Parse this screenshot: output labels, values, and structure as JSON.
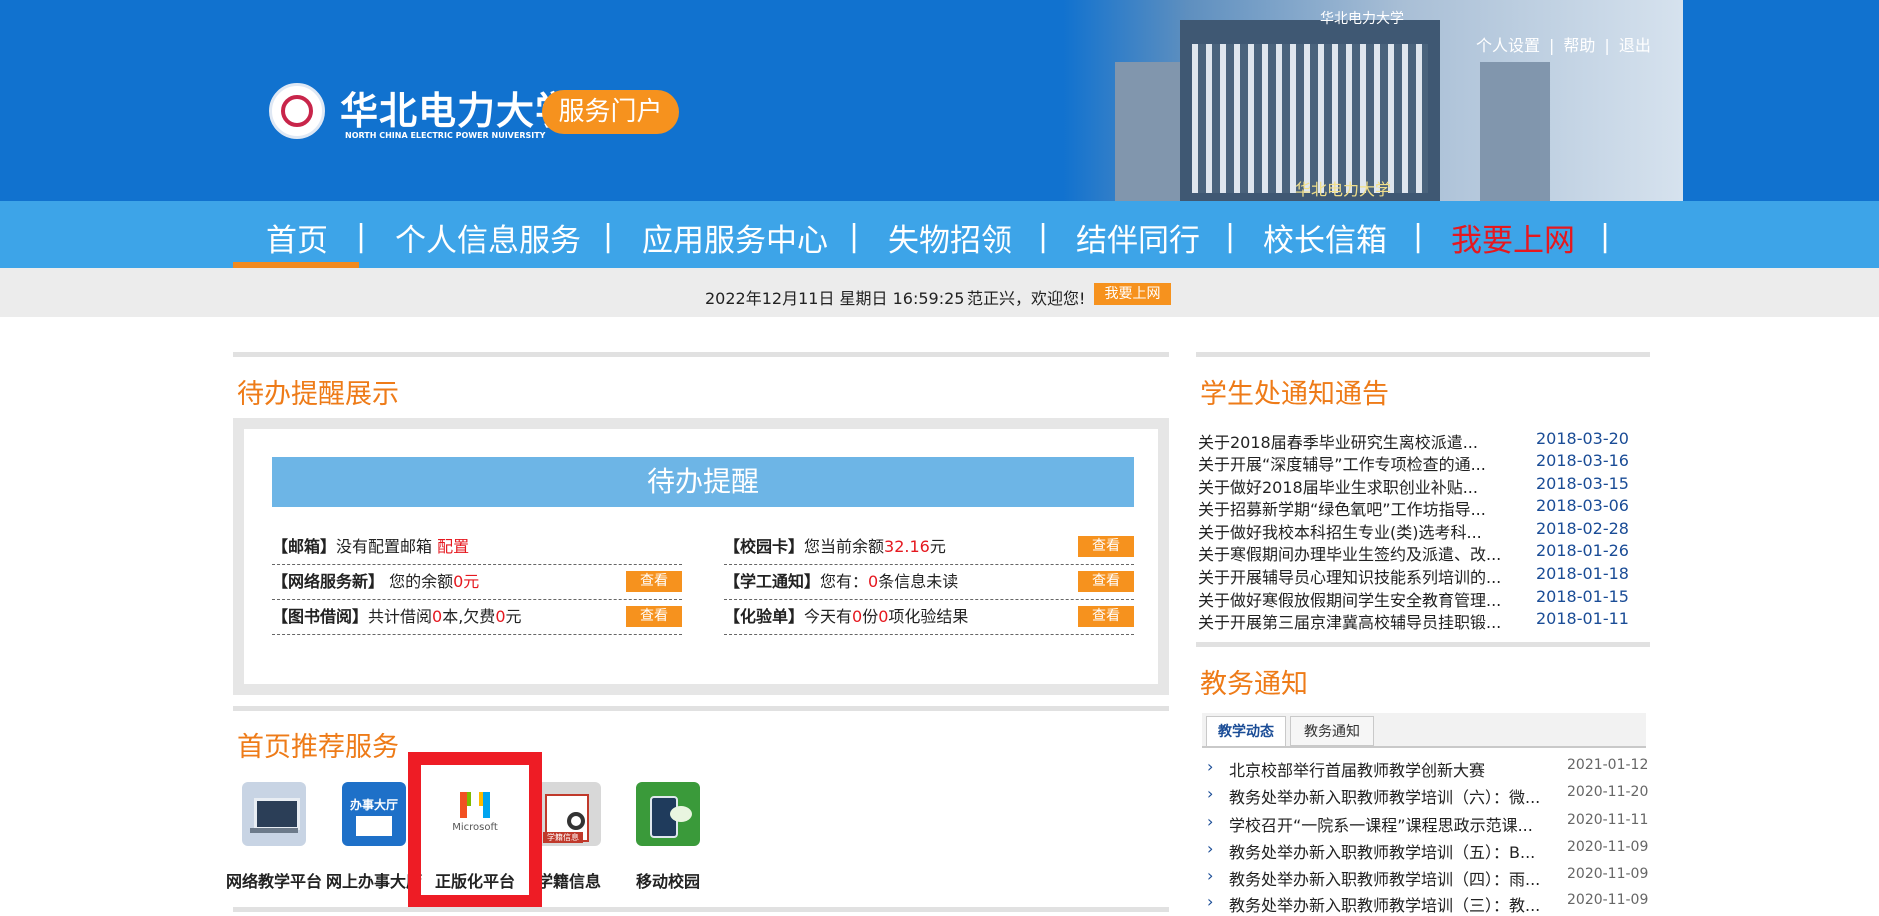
{
  "header": {
    "university_name": "华北电力大学",
    "university_name_en": "NORTH CHINA ELECTRIC POWER NUIVERSITY",
    "portal_label": "服务门户",
    "building_sign": "华北电力大学",
    "building_sign_bottom": "华北电力大学",
    "top_links": [
      "个人设置",
      "帮助",
      "退出"
    ],
    "top_link_sep": "|"
  },
  "nav": {
    "items": [
      "首页",
      "个人信息服务",
      "应用服务中心",
      "失物招领",
      "结伴同行",
      "校长信箱",
      "我要上网"
    ],
    "separator": "|",
    "active_index": 0,
    "highlight_color": "#e5181f"
  },
  "status": {
    "datetime": "2022年12月11日 星期日 16:59:25",
    "welcome": "范正兴，欢迎您!",
    "online_button": "我要上网"
  },
  "todo_section": {
    "title": "待办提醒展示",
    "panel_title": "待办提醒",
    "left": [
      {
        "label": "【邮箱】",
        "t1": "没有配置邮箱 ",
        "v1": "配置",
        "t2": "",
        "v2": "",
        "t3": "",
        "button": ""
      },
      {
        "label": "【网络服务新】",
        "t1": " 您的余额",
        "v1": "0",
        "t2": "元",
        "v2": "",
        "t3": "",
        "button": "查看"
      },
      {
        "label": "【图书借阅】",
        "t1": "共计借阅",
        "v1": "0",
        "t2": "本,欠费",
        "v2": "0",
        "t3": "元",
        "button": "查看"
      }
    ],
    "right": [
      {
        "label": "【校园卡】",
        "t1": "您当前余额",
        "v1": "32.16",
        "t2": "元",
        "v2": "",
        "t3": "",
        "button": "查看"
      },
      {
        "label": "【学工通知】",
        "t1": "您有：",
        "v1": "0",
        "t2": "条信息未读",
        "v2": "",
        "t3": "",
        "button": "查看"
      },
      {
        "label": "【化验单】",
        "t1": "今天有",
        "v1": "0",
        "t2": "份",
        "v2": "0",
        "t3": "项化验结果",
        "button": "查看"
      }
    ]
  },
  "recommend_section": {
    "title": "首页推荐服务",
    "services": [
      {
        "label": "网络教学平台",
        "icon": "laptop-book-icon",
        "color": "#c8d4e4"
      },
      {
        "label": "网上办事大厅",
        "icon": "office-hall-icon",
        "color": "#1e70c8",
        "icon_text": "办事大厅"
      },
      {
        "label": "正版化平台",
        "icon": "microsoft-icon",
        "color": "#ffffff",
        "icon_text": "Microsoft"
      },
      {
        "label": "学籍信息",
        "icon": "student-record-icon",
        "color": "#d8d8d8",
        "icon_text": "学籍信息"
      },
      {
        "label": "移动校园",
        "icon": "mobile-campus-icon",
        "color": "#3a9a3a"
      }
    ]
  },
  "notice_section": {
    "title": "学生处通知通告",
    "items": [
      {
        "title": "关于2018届春季毕业研究生离校派遣...",
        "date": "2018-03-20"
      },
      {
        "title": "关于开展“深度辅导”工作专项检查的通...",
        "date": "2018-03-16"
      },
      {
        "title": "关于做好2018届毕业生求职创业补贴...",
        "date": "2018-03-15"
      },
      {
        "title": "关于招募新学期“绿色氧吧”工作坊指导...",
        "date": "2018-03-06"
      },
      {
        "title": "关于做好我校本科招生专业(类)选考科...",
        "date": "2018-02-28"
      },
      {
        "title": "关于寒假期间办理毕业生签约及派遣、改...",
        "date": "2018-01-26"
      },
      {
        "title": "关于开展辅导员心理知识技能系列培训的...",
        "date": "2018-01-18"
      },
      {
        "title": "关于做好寒假放假期间学生安全教育管理...",
        "date": "2018-01-15"
      },
      {
        "title": "关于开展第三届京津冀高校辅导员挂职锻...",
        "date": "2018-01-11"
      }
    ]
  },
  "edu_section": {
    "title": "教务通知",
    "tabs": [
      "教学动态",
      "教务通知"
    ],
    "arrow": "›",
    "items": [
      {
        "title": "北京校部举行首届教师教学创新大赛",
        "date": "2021-01-12"
      },
      {
        "title": "教务处举办新入职教师教学培训（六）：微...",
        "date": "2020-11-20"
      },
      {
        "title": "学校召开“一院系一课程”课程思政示范课...",
        "date": "2020-11-11"
      },
      {
        "title": "教务处举办新入职教师教学培训（五）：B...",
        "date": "2020-11-09"
      },
      {
        "title": "教务处举办新入职教师教学培训（四）：雨...",
        "date": "2020-11-09"
      },
      {
        "title": "教务处举办新入职教师教学培训（三）：教...",
        "date": "2020-11-09"
      }
    ]
  },
  "colors": {
    "header_blue": "#1172cf",
    "nav_blue": "#3da4e8",
    "accent_orange": "#f6921e",
    "title_orange": "#ee7b18",
    "alert_red": "#e5181f"
  }
}
